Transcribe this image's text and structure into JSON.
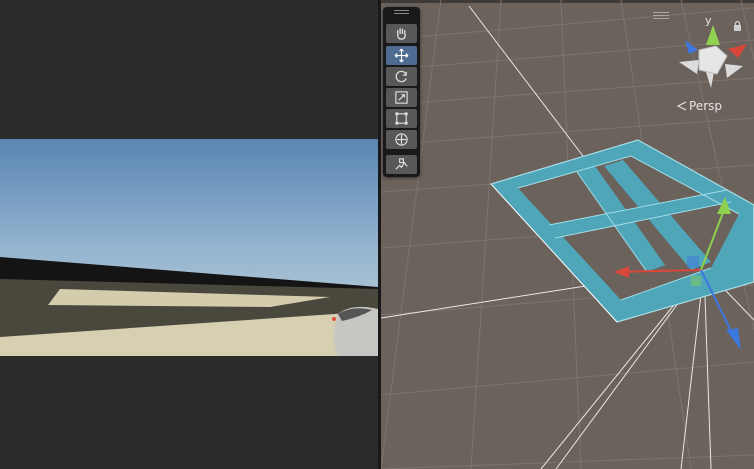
{
  "game_view": {
    "render": "camera-preview-sky-ground-hand"
  },
  "scene_view": {
    "projection_label": "Persp",
    "toolbar": {
      "tools": [
        {
          "name": "hand-tool",
          "icon": "hand-icon",
          "active": false
        },
        {
          "name": "move-tool",
          "icon": "move-arrows-icon",
          "active": true
        },
        {
          "name": "rotate-tool",
          "icon": "rotate-icon",
          "active": false
        },
        {
          "name": "scale-tool",
          "icon": "scale-icon",
          "active": false
        },
        {
          "name": "rect-tool",
          "icon": "rect-transform-icon",
          "active": false
        },
        {
          "name": "transform-tool",
          "icon": "transform-icon",
          "active": false
        },
        {
          "name": "custom-tool",
          "icon": "custom-tool-icon",
          "active": false
        }
      ]
    },
    "gizmo": {
      "axis_label_y": "y",
      "colors": {
        "x": "#d9473b",
        "y": "#8fd14f",
        "z": "#3d77e0",
        "center": "#dcdcdc"
      }
    },
    "selected_object": {
      "colors": {
        "fill": "#4fa6b8",
        "edge": "#9fdce8",
        "outline": "#ffffff"
      }
    }
  },
  "colors": {
    "scene_bg": "#6b625c",
    "editor_dark": "#232323",
    "active_tool": "#4e6c92",
    "tool_bg": "#585858"
  }
}
